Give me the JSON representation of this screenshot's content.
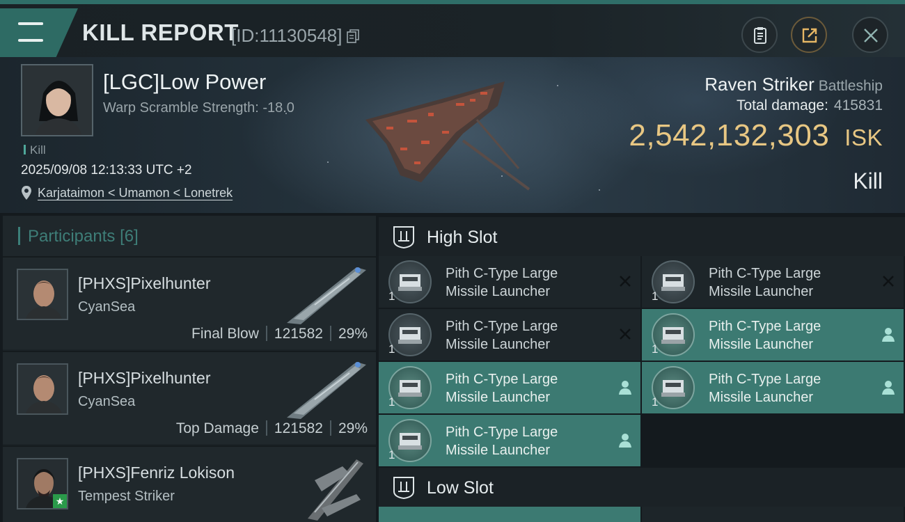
{
  "header": {
    "title": "KILL REPORT",
    "report_id": "[ID:11130548]"
  },
  "victim": {
    "name": "[LGC]Low Power",
    "warp_scramble": "Warp Scramble Strength: -18.0",
    "tag": "Kill",
    "datetime": "2025/09/08 12:13:33 UTC +2",
    "location": "Karjataimon < Umamon < Lonetrek",
    "ship_name": "Raven Striker",
    "ship_class": "Battleship",
    "total_damage_label": "Total damage:",
    "total_damage": "415831",
    "isk_value": "2,542,132,303",
    "isk_unit": "ISK",
    "result": "Kill"
  },
  "participants": {
    "label": "Participants",
    "count": "[6]",
    "items": [
      {
        "name": "[PHXS]Pixelhunter",
        "corp": "CyanSea",
        "role": "Final Blow",
        "damage": "121582",
        "pct": "29%"
      },
      {
        "name": "[PHXS]Pixelhunter",
        "corp": "CyanSea",
        "role": "Top Damage",
        "damage": "121582",
        "pct": "29%"
      },
      {
        "name": "[PHXS]Fenriz Lokison",
        "corp": "Tempest Striker"
      }
    ]
  },
  "slots": {
    "high": {
      "label": "High Slot",
      "modules": [
        {
          "line1": "Pith C-Type Large",
          "line2": "Missile Launcher",
          "qty": "1",
          "state": "destroyed"
        },
        {
          "line1": "Pith C-Type Large",
          "line2": "Missile Launcher",
          "qty": "1",
          "state": "destroyed"
        },
        {
          "line1": "Pith C-Type Large",
          "line2": "Missile Launcher",
          "qty": "1",
          "state": "destroyed"
        },
        {
          "line1": "Pith C-Type Large",
          "line2": "Missile Launcher",
          "qty": "1",
          "state": "dropped"
        },
        {
          "line1": "Pith C-Type Large",
          "line2": "Missile Launcher",
          "qty": "1",
          "state": "dropped"
        },
        {
          "line1": "Pith C-Type Large",
          "line2": "Missile Launcher",
          "qty": "1",
          "state": "dropped"
        },
        {
          "line1": "Pith C-Type Large",
          "line2": "Missile Launcher",
          "qty": "1",
          "state": "dropped"
        }
      ]
    },
    "low": {
      "label": "Low Slot"
    }
  },
  "colors": {
    "accent_teal": "#3c7a72",
    "isk_gold": "#e8c783",
    "background": "#141a1e"
  },
  "icons": [
    "menu-icon",
    "copy-icon",
    "clipboard-icon",
    "share-icon",
    "close-icon",
    "location-pin-icon",
    "slot-icon",
    "missile-launcher-icon",
    "destroyed-x-icon",
    "person-icon",
    "star-badge-icon"
  ]
}
